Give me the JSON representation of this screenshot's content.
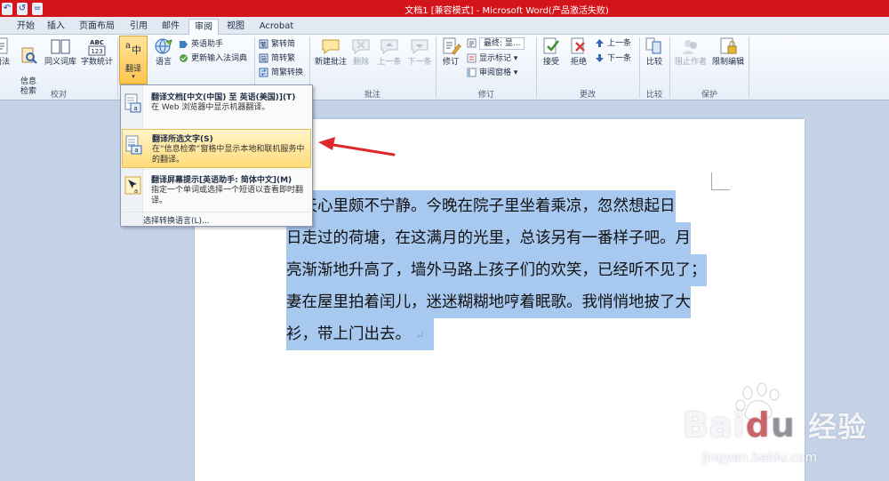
{
  "window": {
    "title": "文档1 [兼容模式] - Microsoft Word(产品激活失败)",
    "qat": [
      "↶",
      "↺",
      "="
    ]
  },
  "tabs": [
    "开始",
    "插入",
    "页面布局",
    "引用",
    "邮件",
    "审阅",
    "视图",
    "Acrobat"
  ],
  "active_tab": "审阅",
  "ribbon": {
    "proofing": {
      "group_label": "校对",
      "grammar_label": "语法",
      "research_label": "信息\n检索",
      "thesaurus_label": "同义词库",
      "wordcount_label": "字数统计"
    },
    "language": {
      "translate_label": "翻译",
      "language_label": "语言",
      "english_assistant": "英语助手",
      "update_ime": "更新输入法词典"
    },
    "chinese": {
      "trad_to_simp": "繁转简",
      "simp_to_trad": "简转繁",
      "convert": "简繁转换",
      "group_label": "中文简繁转换"
    },
    "comments": {
      "group_label": "批注",
      "new_comment": "新建批注",
      "delete": "删除",
      "previous": "上一条",
      "next": "下一条"
    },
    "tracking": {
      "group_label": "修订",
      "track_changes": "修订",
      "final_dropdown": "最终: 显...",
      "show_markup": "显示标记 ▾",
      "review_pane": "审阅窗格 ▾"
    },
    "changes": {
      "group_label": "更改",
      "accept": "接受",
      "reject": "拒绝",
      "previous": "上一条",
      "next": "下一条"
    },
    "compare": {
      "group_label": "比较",
      "compare": "比较"
    },
    "protect": {
      "group_label": "保护",
      "block_authors": "阻止作者",
      "restrict_editing": "限制编辑"
    }
  },
  "translate_menu": {
    "items": [
      {
        "title": "翻译文档[中文(中国) 至 英语(美国)](T)",
        "desc": "在 Web 浏览器中显示机器翻译。"
      },
      {
        "title": "翻译所选文字(S)",
        "desc": "在“信息检索”窗格中显示本地和联机服务中的翻译。"
      },
      {
        "title": "翻译屏幕提示[英语助手: 简体中文](M)",
        "desc": "指定一个单词或选择一个短语以查看即时翻译。"
      }
    ],
    "choose_language": "选择转换语言(L)..."
  },
  "document": {
    "lines": [
      "几天心里颇不宁静。今晚在院子里坐着乘凉，忽然想起日",
      "日走过的荷塘，在这满月的光里，总该另有一番样子吧。月",
      "亮渐渐地升高了，墙外马路上孩子们的欢笑，已经听不见了；",
      "妻在屋里拍着闰儿，迷迷糊糊地哼着眠歌。我悄悄地披了大",
      "衫，带上门出去。"
    ],
    "paragraph_mark": "↵"
  },
  "watermark": {
    "brand": "Bai",
    "brand2": "经验",
    "url": "jingyan.baidu.com"
  },
  "colors": {
    "titlebar": "#d4141b",
    "selection": "#a7c8ef",
    "arrow": "#e0282c"
  }
}
